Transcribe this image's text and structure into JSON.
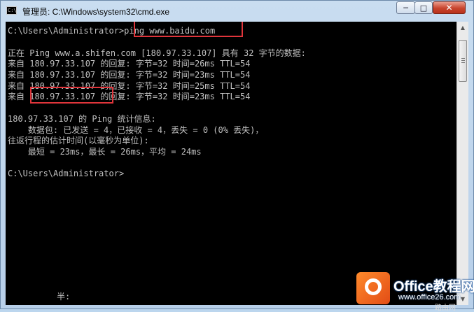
{
  "window": {
    "title": "管理员: C:\\Windows\\system32\\cmd.exe",
    "icon_text": "C:\\",
    "controls": {
      "minimize": "─",
      "maximize": "□",
      "close": "✕"
    }
  },
  "console": {
    "lines": [
      "C:\\Users\\Administrator>ping www.baidu.com",
      "",
      "正在 Ping www.a.shifen.com [180.97.33.107] 具有 32 字节的数据:",
      "来自 180.97.33.107 的回复: 字节=32 时间=26ms TTL=54",
      "来自 180.97.33.107 的回复: 字节=32 时间=23ms TTL=54",
      "来自 180.97.33.107 的回复: 字节=32 时间=25ms TTL=54",
      "来自 180.97.33.107 的回复: 字节=32 时间=23ms TTL=54",
      "",
      "180.97.33.107 的 Ping 统计信息:",
      "    数据包: 已发送 = 4，已接收 = 4，丢失 = 0 (0% 丢失)，",
      "往返行程的估计时间(以毫秒为单位):",
      "    最短 = 23ms，最长 = 26ms，平均 = 24ms",
      "",
      "C:\\Users\\Administrator>"
    ],
    "ime_status": "半:"
  },
  "colors": {
    "console_bg": "#000000",
    "console_text": "#c0c0c0",
    "highlight_border": "#e0353b",
    "close_button": "#c8442d"
  },
  "watermark": {
    "brand": "Office教程网",
    "url": "www.office26.com",
    "extra": "路由网"
  }
}
